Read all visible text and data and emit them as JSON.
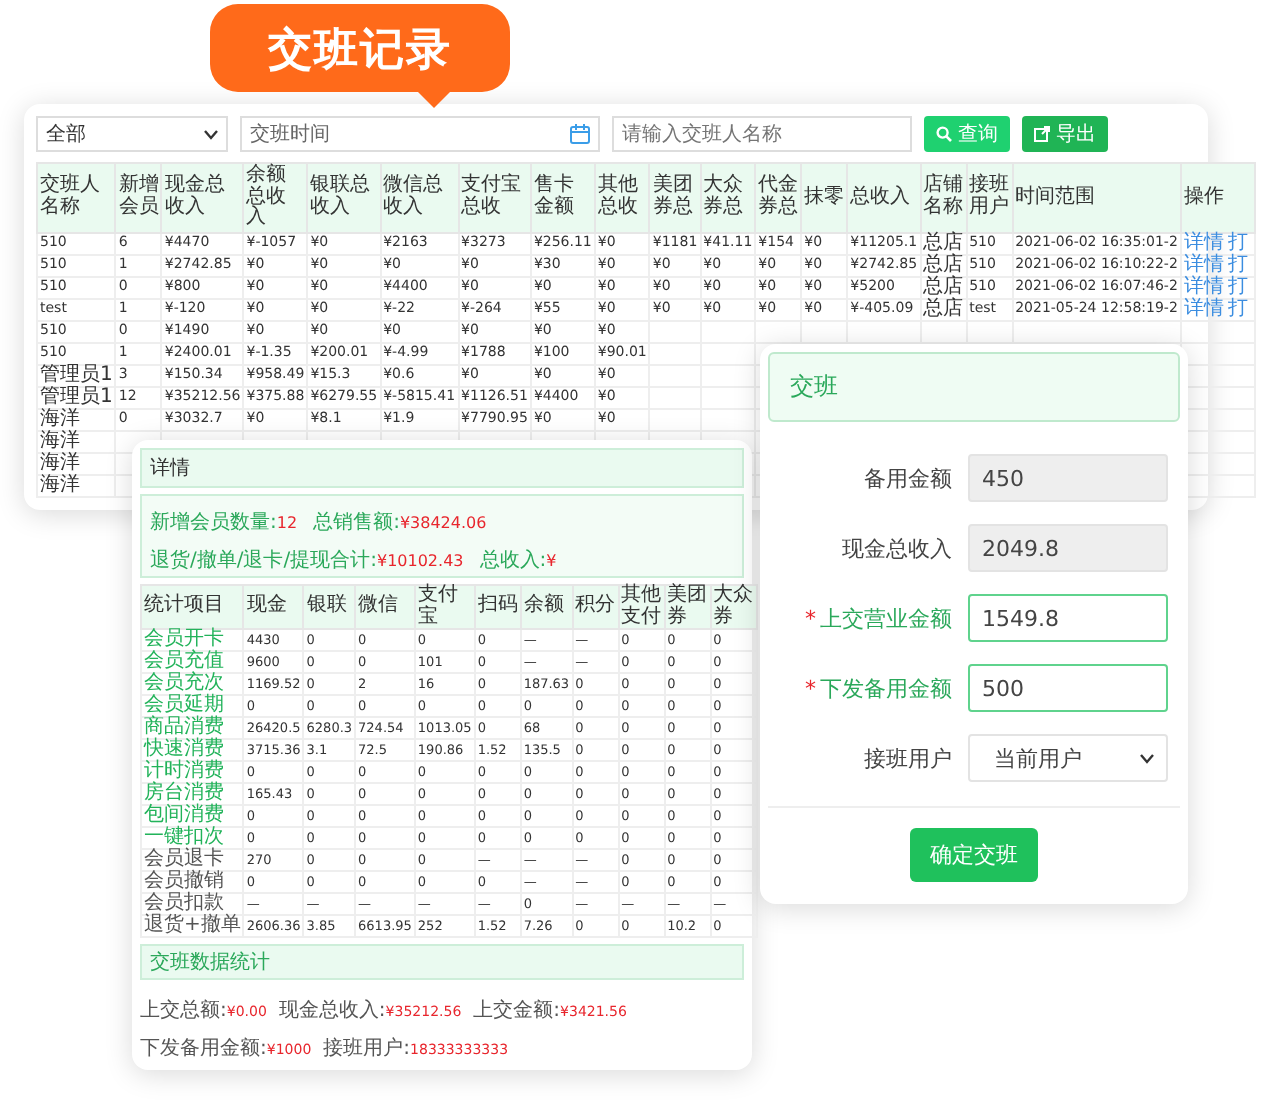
{
  "title_badge": "交班记录",
  "records": {
    "shop_filter": "全部",
    "date_label": "交班时间",
    "search_placeholder": "请输入交班人名称",
    "buttons": [
      {
        "kind": "search",
        "label": "查询"
      },
      {
        "kind": "export",
        "label": "导出"
      }
    ],
    "columns": [
      "交班人名称",
      "新增会员",
      "现金总收入",
      "余额总收入",
      "银联总收入",
      "微信总收入",
      "支付宝总收",
      "售卡金额",
      "其他总收",
      "美团券总",
      "大众券总",
      "代金券总",
      "抹零",
      "总收入",
      "店铺名称",
      "接班用户",
      "时间范围",
      "操作"
    ],
    "rows": [
      {
        "cells": [
          "510",
          "6",
          "¥4470",
          "¥-1057",
          "¥0",
          "¥2163",
          "¥3273",
          "¥256.11",
          "¥0",
          "¥1181",
          "¥41.11",
          "¥154",
          "¥0",
          "¥11205.1",
          "总店",
          "510",
          "2021-06-02 16:35:01-2"
        ],
        "actions": [
          "详情",
          "打"
        ]
      },
      {
        "cells": [
          "510",
          "1",
          "¥2742.85",
          "¥0",
          "¥0",
          "¥0",
          "¥0",
          "¥30",
          "¥0",
          "¥0",
          "¥0",
          "¥0",
          "¥0",
          "¥2742.85",
          "总店",
          "510",
          "2021-06-02 16:10:22-2"
        ],
        "actions": [
          "详情",
          "打"
        ]
      },
      {
        "cells": [
          "510",
          "0",
          "¥800",
          "¥0",
          "¥0",
          "¥4400",
          "¥0",
          "¥0",
          "¥0",
          "¥0",
          "¥0",
          "¥0",
          "¥0",
          "¥5200",
          "总店",
          "510",
          "2021-06-02 16:07:46-2"
        ],
        "actions": [
          "详情",
          "打"
        ]
      },
      {
        "cells": [
          "test",
          "1",
          "¥-120",
          "¥0",
          "¥0",
          "¥-22",
          "¥-264",
          "¥55",
          "¥0",
          "¥0",
          "¥0",
          "¥0",
          "¥0",
          "¥-405.09",
          "总店",
          "test",
          "2021-05-24 12:58:19-2"
        ],
        "actions": [
          "详情",
          "打"
        ]
      },
      {
        "cells": [
          "510",
          "0",
          "¥1490",
          "¥0",
          "¥0",
          "¥0",
          "¥0",
          "¥0",
          "¥0"
        ]
      },
      {
        "cells": [
          "510",
          "1",
          "¥2400.01",
          "¥-1.35",
          "¥200.01",
          "¥-4.99",
          "¥1788",
          "¥100",
          "¥90.01"
        ]
      },
      {
        "cells": [
          "管理员1",
          "3",
          "¥150.34",
          "¥958.49",
          "¥15.3",
          "¥0.6",
          "¥0",
          "¥0",
          "¥0"
        ]
      },
      {
        "cells": [
          "管理员1",
          "12",
          "¥35212.56",
          "¥375.88",
          "¥6279.55",
          "¥-5815.41",
          "¥1126.51",
          "¥4400",
          "¥0"
        ]
      },
      {
        "cells": [
          "海洋",
          "0",
          "¥3032.7",
          "¥0",
          "¥8.1",
          "¥1.9",
          "¥7790.95",
          "¥0",
          "¥0"
        ]
      },
      {
        "cells": [
          "海洋"
        ]
      },
      {
        "cells": [
          "海洋"
        ]
      },
      {
        "cells": [
          "海洋"
        ]
      }
    ]
  },
  "detail": {
    "title": "详情",
    "summary": [
      {
        "label": "新增会员数量:",
        "value": "12"
      },
      {
        "label": "总销售额:",
        "value": "¥38424.06"
      },
      {
        "label": "退货/撤单/退卡/提现合计:",
        "value": "¥10102.43"
      },
      {
        "label": "总收入:",
        "value": "¥"
      }
    ],
    "columns": [
      "统计项目",
      "现金",
      "银联",
      "微信",
      "支付宝",
      "扫码",
      "余额",
      "积分",
      "其他支付",
      "美团券",
      "大众券"
    ],
    "rows": [
      {
        "item": "会员开卡",
        "link": true,
        "values": [
          "4430",
          "0",
          "0",
          "0",
          "0",
          "—",
          "—",
          "0",
          "0",
          "0"
        ]
      },
      {
        "item": "会员充值",
        "link": true,
        "values": [
          "9600",
          "0",
          "0",
          "101",
          "0",
          "—",
          "—",
          "0",
          "0",
          "0"
        ]
      },
      {
        "item": "会员充次",
        "link": true,
        "values": [
          "1169.52",
          "0",
          "2",
          "16",
          "0",
          "187.63",
          "0",
          "0",
          "0",
          "0"
        ]
      },
      {
        "item": "会员延期",
        "link": true,
        "values": [
          "0",
          "0",
          "0",
          "0",
          "0",
          "0",
          "0",
          "0",
          "0",
          "0"
        ]
      },
      {
        "item": "商品消费",
        "link": true,
        "values": [
          "26420.5",
          "6280.3",
          "724.54",
          "1013.05",
          "0",
          "68",
          "0",
          "0",
          "0",
          "0"
        ]
      },
      {
        "item": "快速消费",
        "link": true,
        "values": [
          "3715.36",
          "3.1",
          "72.5",
          "190.86",
          "1.52",
          "135.5",
          "0",
          "0",
          "0",
          "0"
        ]
      },
      {
        "item": "计时消费",
        "link": true,
        "values": [
          "0",
          "0",
          "0",
          "0",
          "0",
          "0",
          "0",
          "0",
          "0",
          "0"
        ]
      },
      {
        "item": "房台消费",
        "link": true,
        "values": [
          "165.43",
          "0",
          "0",
          "0",
          "0",
          "0",
          "0",
          "0",
          "0",
          "0"
        ]
      },
      {
        "item": "包间消费",
        "link": true,
        "values": [
          "0",
          "0",
          "0",
          "0",
          "0",
          "0",
          "0",
          "0",
          "0",
          "0"
        ]
      },
      {
        "item": "一键扣次",
        "link": true,
        "values": [
          "0",
          "0",
          "0",
          "0",
          "0",
          "0",
          "0",
          "0",
          "0",
          "0"
        ]
      },
      {
        "item": "会员退卡",
        "link": false,
        "values": [
          "270",
          "0",
          "0",
          "0",
          "—",
          "—",
          "—",
          "0",
          "0",
          "0"
        ]
      },
      {
        "item": "会员撤销",
        "link": false,
        "values": [
          "0",
          "0",
          "0",
          "0",
          "0",
          "—",
          "—",
          "0",
          "0",
          "0"
        ]
      },
      {
        "item": "会员扣款",
        "link": false,
        "values": [
          "—",
          "—",
          "—",
          "—",
          "—",
          "0",
          "—",
          "—",
          "—",
          "—"
        ]
      },
      {
        "item": "退货+撤单",
        "link": false,
        "values": [
          "2606.36",
          "3.85",
          "6613.95",
          "252",
          "1.52",
          "7.26",
          "0",
          "0",
          "10.2",
          "0"
        ]
      }
    ],
    "section": "交班数据统计",
    "totals": [
      {
        "label": "上交总额:",
        "value": "¥0.00"
      },
      {
        "label": "现金总收入:",
        "value": "¥35212.56"
      },
      {
        "label": "上交金额:",
        "value": "¥3421.56"
      },
      {
        "label": "下发备用金额:",
        "value": "¥1000"
      },
      {
        "label": "接班用户:",
        "value": "18333333333"
      }
    ]
  },
  "modal": {
    "title": "交班",
    "fields": [
      {
        "kind": "readonly",
        "label": "备用金额",
        "value": "450"
      },
      {
        "kind": "readonly",
        "label": "现金总收入",
        "value": "2049.8"
      },
      {
        "kind": "input",
        "label": "上交营业金额",
        "value": "1549.8",
        "required_mark": "*"
      },
      {
        "kind": "input",
        "label": "下发备用金额",
        "value": "500",
        "required_mark": "*"
      },
      {
        "kind": "select",
        "label": "接班用户",
        "value": "当前用户"
      }
    ],
    "submit": "确定交班"
  }
}
